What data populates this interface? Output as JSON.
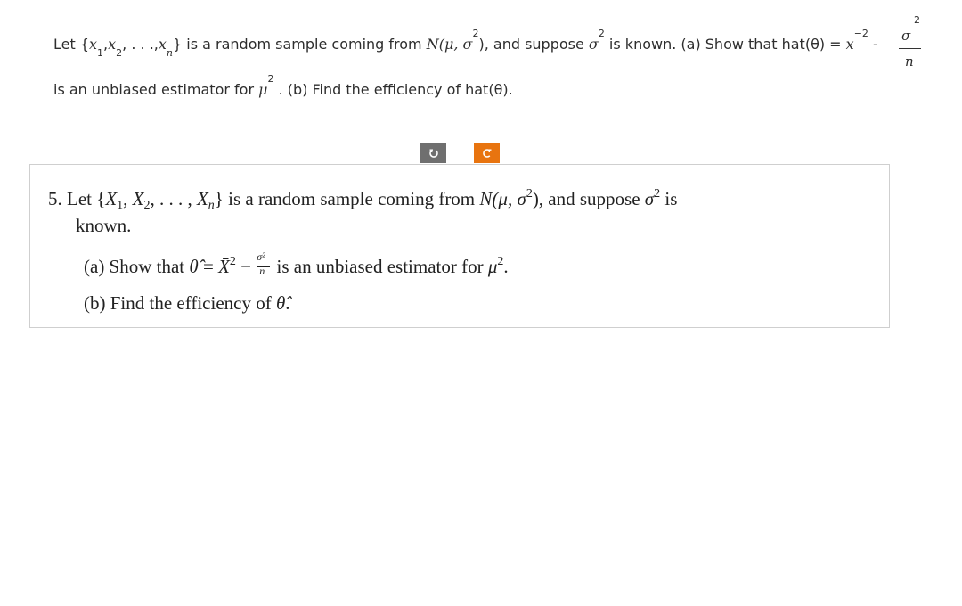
{
  "question": {
    "line1": {
      "let": "Let {",
      "x": "x",
      "sub1": "1",
      "sub2": "2",
      "subn": "n",
      "comma": ",",
      "dots": ", . . .,",
      "rest": "} is a random sample coming from ",
      "N": "N",
      "mu_sigma": "(μ, σ",
      "sup2": "2",
      "after_dist": "), and suppose ",
      "sigma": "σ",
      "known": " is known. (a) Show that hat(θ) = ",
      "xbar_sup": "−2",
      "minus": " - ",
      "frac_num": "σ",
      "frac_den": "n"
    },
    "line2": {
      "text": "is an unbiased estimator for ",
      "mu": "μ",
      "sup2": "2",
      "rest": " . (b) Find the efficiency of hat(θ)."
    }
  },
  "toolbar": {
    "rotate_clockwise_icon": "rotate-clockwise",
    "rotate_counterclockwise_icon": "rotate-counterclockwise",
    "rotate_clockwise_color": "#6f6f6f",
    "rotate_counterclockwise_color": "#e8740f"
  },
  "image_content": {
    "number": "5.",
    "line1_a": "Let {",
    "X": "X",
    "s1": "1",
    "s2": "2",
    "sn": "n",
    "dots": ", . . . , ",
    "line1_b": "} is a random sample coming from ",
    "N": "N",
    "dist": "(μ, σ",
    "two": "2",
    "line1_c": "), and suppose ",
    "sigma": "σ",
    "line1_d": " is",
    "line2": "known.",
    "part_a_label": "(a) Show that ",
    "theta_hat": "θ̂",
    "eq": " = ",
    "xbar": "X̄",
    "minus": " − ",
    "frac_num": "σ²",
    "frac_den": "n",
    "part_a_rest": " is an unbiased estimator for ",
    "mu": "μ",
    "period": ".",
    "part_b_label": "(b) Find the efficiency of ",
    "part_b_end": "."
  }
}
